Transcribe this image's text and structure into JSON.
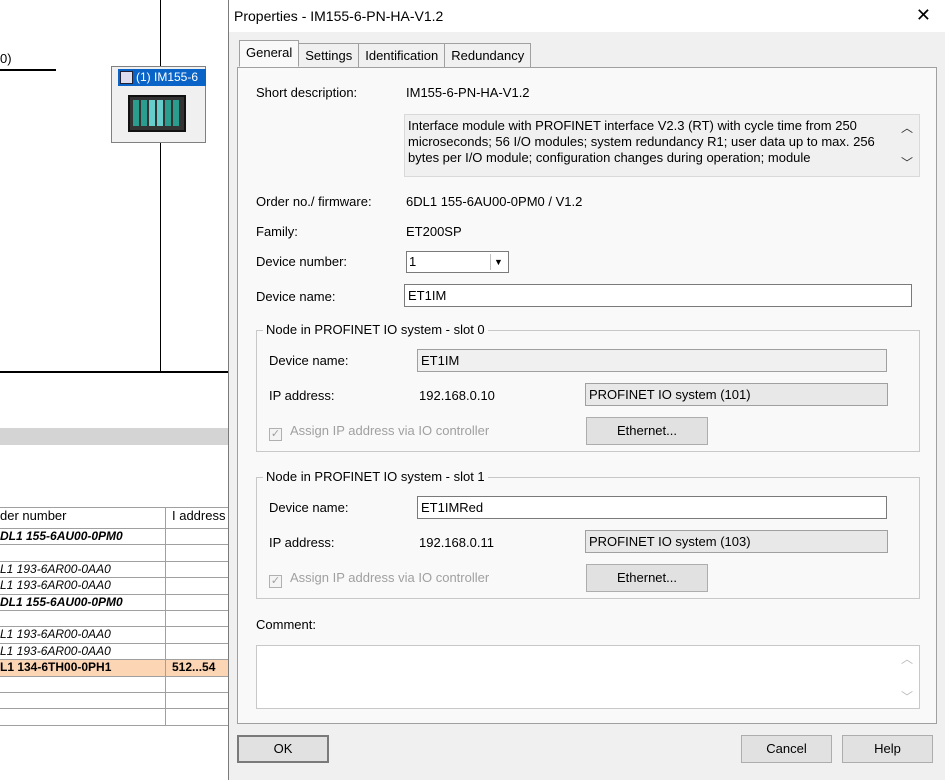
{
  "background": {
    "connector_label": "0)",
    "module_label": "(1) IM155-6",
    "table": {
      "headers": [
        "der number",
        "I address"
      ],
      "rows": [
        {
          "order": "DL1 155-6AU00-0PM0",
          "addr": "",
          "style": "bold"
        },
        {
          "order": "",
          "addr": "",
          "style": ""
        },
        {
          "order": "L1 193-6AR00-0AA0",
          "addr": "",
          "style": "ital"
        },
        {
          "order": "L1 193-6AR00-0AA0",
          "addr": "",
          "style": "ital"
        },
        {
          "order": "DL1 155-6AU00-0PM0",
          "addr": "",
          "style": "bold"
        },
        {
          "order": "",
          "addr": "",
          "style": ""
        },
        {
          "order": "L1 193-6AR00-0AA0",
          "addr": "",
          "style": "ital"
        },
        {
          "order": "L1 193-6AR00-0AA0",
          "addr": "",
          "style": "ital"
        },
        {
          "order": "L1 134-6TH00-0PH1",
          "addr": "512...54",
          "style": "sel"
        },
        {
          "order": "",
          "addr": "",
          "style": ""
        },
        {
          "order": "",
          "addr": "",
          "style": ""
        },
        {
          "order": "",
          "addr": "",
          "style": ""
        }
      ]
    }
  },
  "dialog": {
    "title": "Properties - IM155-6-PN-HA-V1.2",
    "close_glyph": "✕",
    "tabs": [
      "General",
      "Settings",
      "Identification",
      "Redundancy"
    ],
    "short_description_label": "Short description:",
    "short_description": "IM155-6-PN-HA-V1.2",
    "description_text": "Interface module with PROFINET interface V2.3 (RT) with cycle time from 250 microseconds; 56 I/O modules; system redundancy R1; user data up to max. 256 bytes per I/O module; configuration changes during operation; module",
    "order_label": "Order no./ firmware:",
    "order_value": "6DL1 155-6AU00-0PM0 / V1.2",
    "family_label": "Family:",
    "family_value": "ET200SP",
    "device_number_label": "Device number:",
    "device_number_value": "1",
    "device_name_label": "Device name:",
    "device_name_value": "ET1IM",
    "slot0": {
      "legend": "Node in PROFINET IO system - slot 0",
      "device_name_label": "Device name:",
      "device_name_value": "ET1IM",
      "ip_label": "IP address:",
      "ip_value": "192.168.0.10",
      "system_value": "PROFINET IO system (101)",
      "assign_label": "Assign IP address via IO controller",
      "ethernet_button": "Ethernet..."
    },
    "slot1": {
      "legend": "Node in PROFINET IO system - slot 1",
      "device_name_label": "Device name:",
      "device_name_value": "ET1IMRed",
      "ip_label": "IP address:",
      "ip_value": "192.168.0.11",
      "system_value": "PROFINET IO system (103)",
      "assign_label": "Assign IP address via IO controller",
      "ethernet_button": "Ethernet..."
    },
    "comment_label": "Comment:",
    "ok_button": "OK",
    "cancel_button": "Cancel",
    "help_button": "Help"
  }
}
